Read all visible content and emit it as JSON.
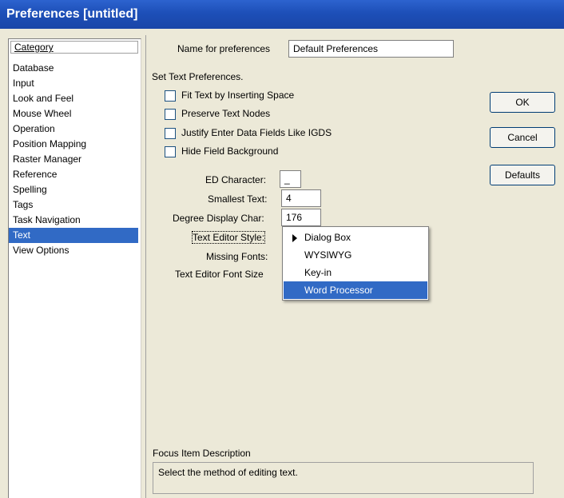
{
  "window": {
    "title": "Preferences [untitled]"
  },
  "sidebar": {
    "header": "Category",
    "items": [
      "Database",
      "Input",
      "Look and Feel",
      "Mouse Wheel",
      "Operation",
      "Position Mapping",
      "Raster Manager",
      "Reference",
      "Spelling",
      "Tags",
      "Task Navigation",
      "Text",
      "View Options"
    ],
    "selected": "Text"
  },
  "prefs_name": {
    "label": "Name for preferences",
    "value": "Default Preferences"
  },
  "section_title": "Set Text Preferences.",
  "checkboxes": [
    {
      "label": "Fit Text by Inserting Space",
      "checked": false
    },
    {
      "label": "Preserve Text Nodes",
      "checked": false
    },
    {
      "label": "Justify Enter Data Fields Like IGDS",
      "checked": false
    },
    {
      "label": "Hide Field Background",
      "checked": false
    }
  ],
  "fields": {
    "ed_character": {
      "label": "ED Character:",
      "value": "_"
    },
    "smallest_text": {
      "label": "Smallest Text:",
      "value": "4"
    },
    "degree_char": {
      "label": "Degree Display Char:",
      "value": "176"
    },
    "editor_style": {
      "label": "Text Editor Style:"
    },
    "missing_fonts": {
      "label": "Missing Fonts:"
    },
    "editor_font_size": {
      "label": "Text Editor Font Size"
    }
  },
  "dropdown": {
    "options": [
      "Dialog Box",
      "WYSIWYG",
      "Key-in",
      "Word Processor"
    ],
    "current": "Dialog Box",
    "highlighted": "Word Processor"
  },
  "buttons": {
    "ok": "OK",
    "cancel": "Cancel",
    "defaults": "Defaults"
  },
  "focus": {
    "label": "Focus Item Description",
    "text": "Select the method of editing text."
  },
  "colors": {
    "selection": "#316ac5",
    "titlebar": "#1d4fb8",
    "dialog_bg": "#ece9d8"
  }
}
